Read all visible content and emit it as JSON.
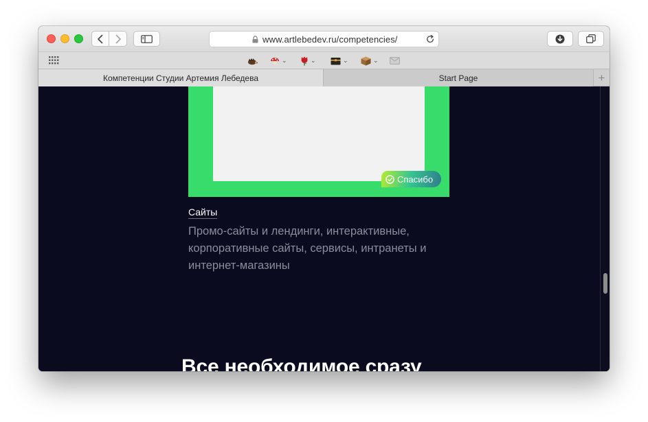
{
  "browser": {
    "url": "www.artlebedev.ru/competencies/",
    "tabs": [
      {
        "label": "Компетенции Студии Артемия Лебедева",
        "active": true
      },
      {
        "label": "Start Page",
        "active": false
      }
    ],
    "new_tab_label": "+",
    "toolbar_icons": [
      "back-chevron-icon",
      "forward-chevron-icon",
      "sidebar-icon",
      "download-icon",
      "tabs-overview-icon",
      "reload-icon",
      "lock-icon"
    ],
    "favorites_icons": [
      "grid-icon",
      "hedgehog-icon",
      "mushroom-icon",
      "rose-icon",
      "chest-icon",
      "box-icon",
      "envelope-icon"
    ]
  },
  "page": {
    "badge_label": "Спасибо",
    "section_title": "Сайты",
    "section_desc": "Промо-сайты и лендинги, интерактивные, корпоративные сайты, сервисы, интранеты и интернет-магазины",
    "big_heading": "Все необходимое сразу"
  },
  "colors": {
    "page_background": "#0a0b1e",
    "card_green": "#38dc6b",
    "panel_white": "#f2f2f2",
    "desc_gray": "#8b8d9c"
  }
}
